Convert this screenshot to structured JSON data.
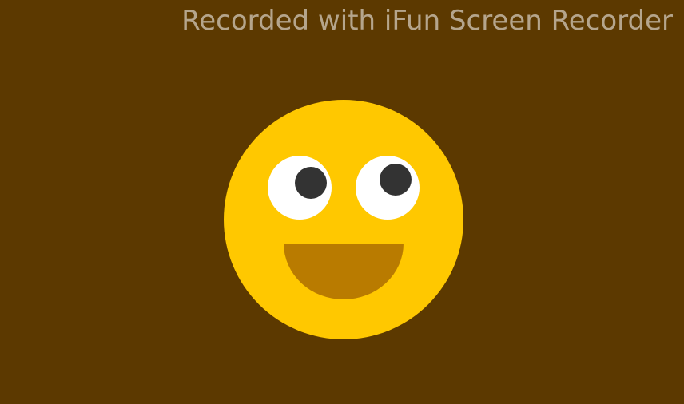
{
  "watermark": {
    "text": "Recorded with iFun Screen Recorder"
  },
  "colors": {
    "background": "#5c3900",
    "face": "#ffc800",
    "eye_white": "#ffffff",
    "pupil": "#333333",
    "mouth": "#b97b00"
  }
}
